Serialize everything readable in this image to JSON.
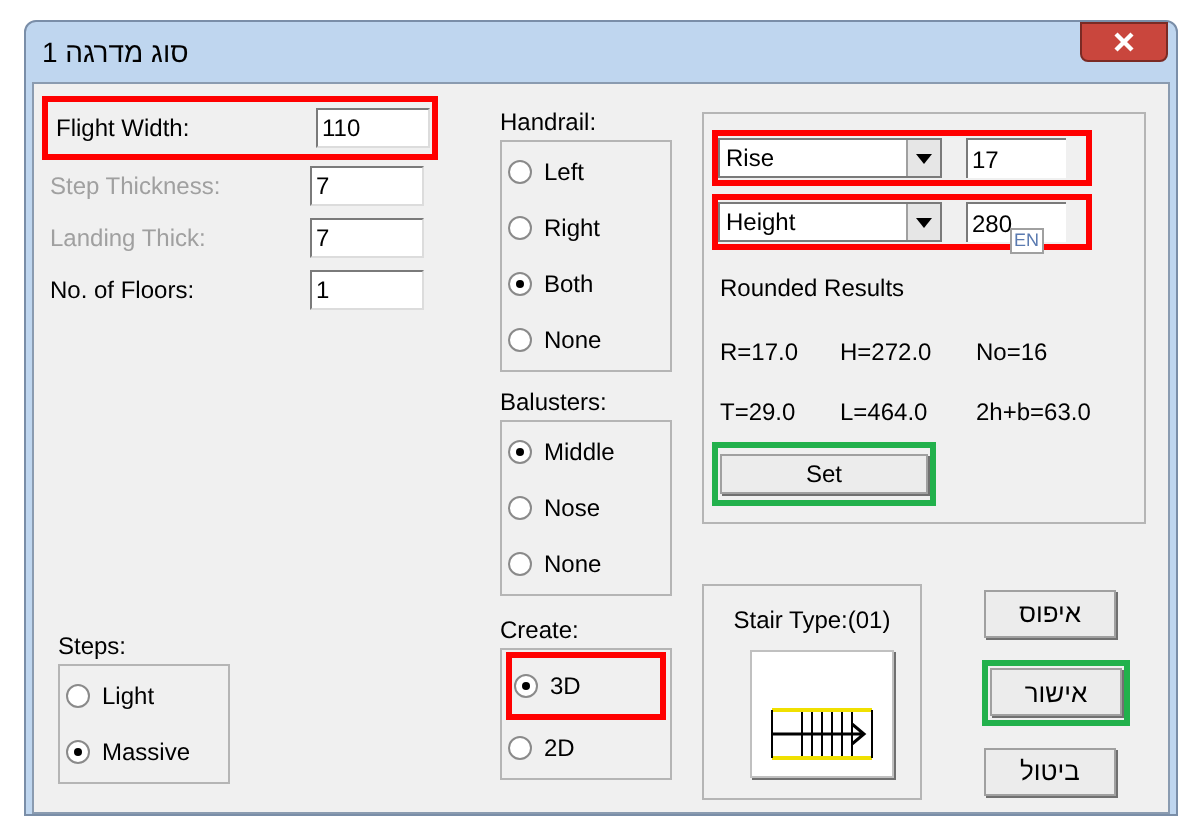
{
  "window": {
    "title": "סוג מדרגה 1"
  },
  "fields": [
    {
      "label": "Flight Width:",
      "value": "110",
      "disabled": false,
      "color": "#ff0000"
    },
    {
      "label": "Step Thickness:",
      "value": "7",
      "disabled": true
    },
    {
      "label": "Landing Thick:",
      "value": "7",
      "disabled": true
    },
    {
      "label": "No. of Floors:",
      "value": "1",
      "disabled": false
    }
  ],
  "steps": {
    "label": "Steps:",
    "options": [
      {
        "label": "Light",
        "selected": false
      },
      {
        "label": "Massive",
        "selected": true
      }
    ]
  },
  "handrail": {
    "label": "Handrail:",
    "options": [
      {
        "label": "Left",
        "selected": false
      },
      {
        "label": "Right",
        "selected": false
      },
      {
        "label": "Both",
        "selected": true
      },
      {
        "label": "None",
        "selected": false
      }
    ]
  },
  "balusters": {
    "label": "Balusters:",
    "options": [
      {
        "label": "Middle",
        "selected": true
      },
      {
        "label": "Nose",
        "selected": false
      },
      {
        "label": "None",
        "selected": false
      }
    ]
  },
  "create": {
    "label": "Create:",
    "options": [
      {
        "label": "3D",
        "selected": true,
        "color": "#ff0000"
      },
      {
        "label": "2D",
        "selected": false
      }
    ]
  },
  "calculator": {
    "rows": [
      {
        "dropdown": "Rise",
        "value": "17",
        "color": "#ff0000"
      },
      {
        "dropdown": "Height",
        "value": "280",
        "color": "#ff0000"
      }
    ],
    "ime_indicator": "EN",
    "results_title": "Rounded Results",
    "results": [
      "R=17.0",
      "H=272.0",
      "No=16",
      "T=29.0",
      "L=464.0",
      "2h+b=63.0"
    ],
    "set_button": {
      "label": "Set",
      "color": "#22b14c"
    }
  },
  "stair_type": {
    "label": "Stair Type:(01)"
  },
  "buttons": [
    {
      "label": "איפוס"
    },
    {
      "label": "אישור",
      "color": "#22b14c"
    },
    {
      "label": "ביטול"
    }
  ]
}
